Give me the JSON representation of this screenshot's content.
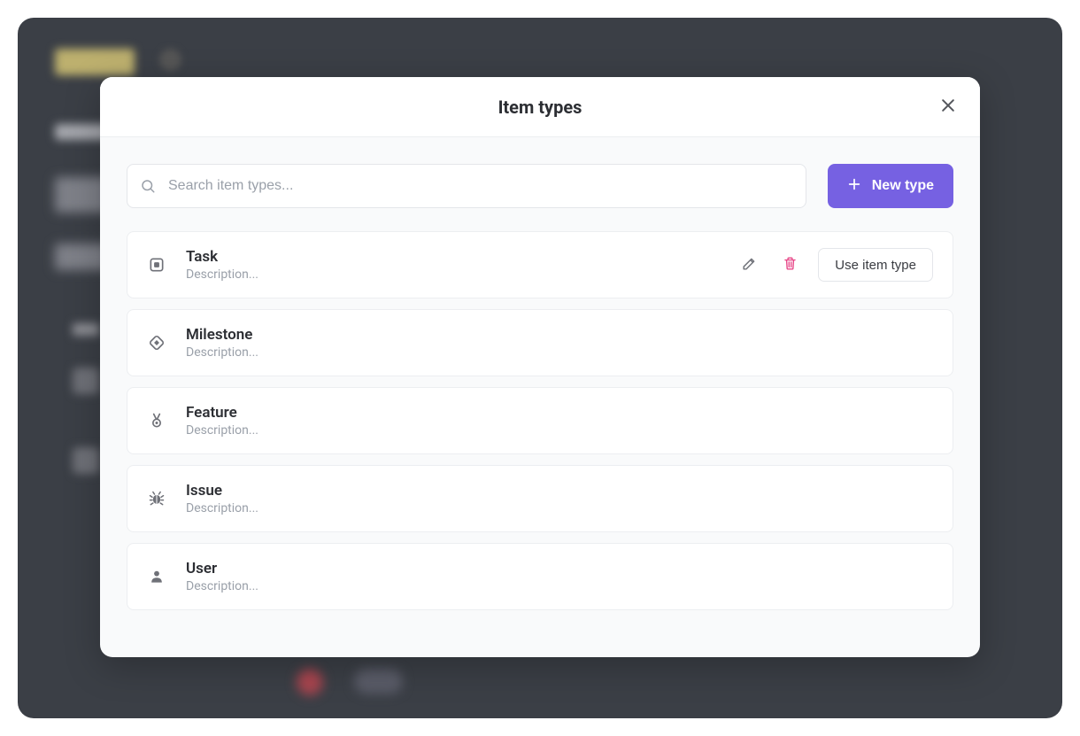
{
  "modal": {
    "title": "Item types",
    "search_placeholder": "Search item types...",
    "new_type_label": "New type",
    "use_label": "Use item type"
  },
  "types": [
    {
      "name": "Task",
      "description": "Description...",
      "icon": "square",
      "active": true
    },
    {
      "name": "Milestone",
      "description": "Description...",
      "icon": "diamond",
      "active": false
    },
    {
      "name": "Feature",
      "description": "Description...",
      "icon": "medal",
      "active": false
    },
    {
      "name": "Issue",
      "description": "Description...",
      "icon": "bug",
      "active": false
    },
    {
      "name": "User",
      "description": "Description...",
      "icon": "user",
      "active": false
    }
  ]
}
